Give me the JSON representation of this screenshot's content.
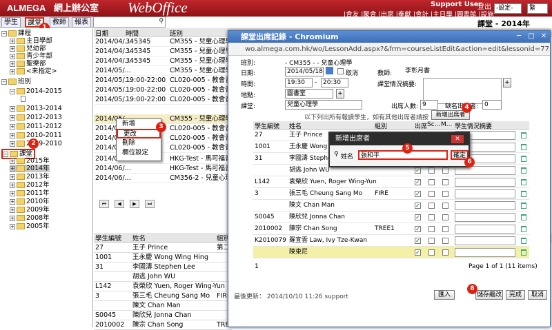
{
  "app": {
    "brand": "ALMEGA",
    "title_cn": "網上辦公室",
    "title_en": "WebOffice",
    "user": "Support User",
    "logout": "登出",
    "nav": [
      "|會友",
      "|聚會",
      "|出席",
      "|奉獻",
      "|會計",
      "|主日學",
      "|圖書館",
      "|設施"
    ],
    "select1": "-設定-",
    "select2": "繁",
    "right_title": "課堂 - 2014年"
  },
  "left_tabs": [
    "學生",
    "課堂",
    "教師",
    "報表"
  ],
  "tree": [
    {
      "label": "課程",
      "type": "pm"
    },
    {
      "label": "主日學部"
    },
    {
      "label": "兒幼部"
    },
    {
      "label": "青少年部"
    },
    {
      "label": "聖樂部"
    },
    {
      "label": "<未指定>"
    },
    {
      "label": "班別",
      "type": "pm"
    },
    {
      "label": "2014-2015"
    },
    {
      "label": ""
    },
    {
      "label": "2013-2014"
    },
    {
      "label": "2012-2013"
    },
    {
      "label": "2011-2012"
    },
    {
      "label": "2010-2011"
    },
    {
      "label": "2009-2010"
    },
    {
      "label": "課堂",
      "type": "pm"
    },
    {
      "label": "2015年"
    },
    {
      "label": "2014年"
    },
    {
      "label": "2013年"
    },
    {
      "label": "2012年"
    },
    {
      "label": "2011年"
    },
    {
      "label": "2010年"
    },
    {
      "label": "2009年"
    },
    {
      "label": "2008年"
    },
    {
      "label": "2005年"
    }
  ],
  "grid": {
    "headers": [
      "日期",
      "時間",
      "班別"
    ],
    "rows": [
      [
        "2014/04/...",
        "345345",
        "CM355 - 兒童心理學"
      ],
      [
        "2014/04/...",
        "345345",
        "CM355 - 兒童心理學"
      ],
      [
        "2014/04/...",
        "345345",
        "CM355 - 兒童心理學"
      ],
      [
        "2014/05/...",
        "",
        "CM355 - 兒童心理學"
      ],
      [
        "2014/05/...",
        "19:00-22:00",
        "CL020-005 - 教會音樂"
      ],
      [
        "2014/05/...",
        "19:00-22:00",
        "CL020-005 - 教會音樂"
      ],
      [
        "2014/05/...",
        "19:00-22:00",
        "CL020-005 - 教會音樂"
      ],
      [
        "2014/05/",
        "",
        "CM355 - 兒童心理學"
      ],
      [
        "2014/05/",
        "",
        "CL020-005 - 教會音樂"
      ],
      [
        "2014/05/",
        "",
        "CL020-005 - 教會音樂"
      ],
      [
        "2014/05/",
        "",
        "CL020-005 - 教會音樂"
      ],
      [
        "2014/06/",
        "",
        "HKG-Test - 馬可福音研"
      ],
      [
        "2014/06/...",
        "",
        "HKG-Test - 馬可福音研"
      ],
      [
        "2014/06/...",
        "",
        "CM356-2 - 兒童心理學"
      ]
    ]
  },
  "context_menu": [
    "新增",
    "更改",
    "刪除",
    "欄位設定"
  ],
  "bottom": {
    "headers": [
      "學生編號",
      "姓名",
      "組別"
    ],
    "rows": [
      [
        "27",
        "王子 Prince",
        "第二組"
      ],
      [
        "1001",
        "王永慶 Wong Wing Hing",
        ""
      ],
      [
        "31",
        "李國濤 Stephen Lee",
        ""
      ],
      [
        "",
        "胡逃 John WU",
        ""
      ],
      [
        "L142",
        "袁榮欣 Yuen, Roger Wing-Yun",
        ""
      ],
      [
        "3",
        "張三毛 Cheung Sang Mo",
        "FIRE"
      ],
      [
        "",
        "陳文 Chan Man",
        ""
      ],
      [
        "S0045",
        "陳欣兒 Jonna Chan",
        ""
      ],
      [
        "2010002",
        "陳宗 Chan Song",
        "TREE1"
      ]
    ]
  },
  "window": {
    "title": "課堂出席記錄 - Chromium",
    "url": "wo.almega.com.hk/wo/LessonAdd.aspx?&frm=courseListEdit&action=edit&lessonid=775&classid",
    "f_class_label": "班別:",
    "f_class": "- CM355 - - 兒童心理學",
    "f_date_label": "日期:",
    "f_date": "2014/05/18",
    "f_cancel": "取消",
    "f_teacher_label": "教師:",
    "f_teacher": "李彰月書",
    "f_time_label": "時間:",
    "f_t1": "19:30",
    "f_t2": "20:30",
    "f_summary_label": "課堂情況摘要:",
    "f_place_label": "地點:",
    "f_place": "圖書室",
    "f_lesson_label": "課堂:",
    "f_lesson": "兒童心理學",
    "f_att_label": "出席人數:",
    "f_att": "9",
    "f_abs_label": "缺名出席者:",
    "f_abs": "0",
    "hint": "以下列出所有報讀學生，如有其他出席者請按",
    "add_btn": "新增出席者",
    "headers": [
      "學生編號",
      "姓名",
      "組別",
      "出席",
      "Sc...",
      "M...",
      "學生情況摘要"
    ],
    "rows": [
      [
        "27",
        "王子 Prince",
        ""
      ],
      [
        "1001",
        "王永慶 Wong W",
        ""
      ],
      [
        "31",
        "李國濤 Stephen",
        ""
      ],
      [
        "",
        "胡逃 John WU",
        ""
      ],
      [
        "L142",
        "袁榮欣 Yuen, Roger Wing-Yun",
        ""
      ],
      [
        "3",
        "張三毛 Cheung Sang Mo",
        "FIRE"
      ],
      [
        "",
        "陳文 Chan Man",
        ""
      ],
      [
        "S0045",
        "陳欣兒 Jonna Chan",
        ""
      ],
      [
        "2010002",
        "陳宗 Chan Song",
        "TREE1"
      ],
      [
        "K2010079",
        "羅宜雲 Law, Ivy Tze-Kwan",
        ""
      ],
      [
        "",
        "陳東尼",
        ""
      ]
    ],
    "page_info": "Page 1 of 1 (11 items)",
    "footer": "最後更新： 2014/10/10 11:26 support",
    "btn_import": "匯入",
    "btn_save": "儲存繼改",
    "btn_done": "完成",
    "btn_cancel": "取消"
  },
  "dialog": {
    "title": "新增出席者",
    "name_label": "姓名",
    "name_value": "張和平",
    "confirm": "確定"
  },
  "badges": [
    "1",
    "2",
    "3",
    "4",
    "5",
    "6",
    "8"
  ]
}
